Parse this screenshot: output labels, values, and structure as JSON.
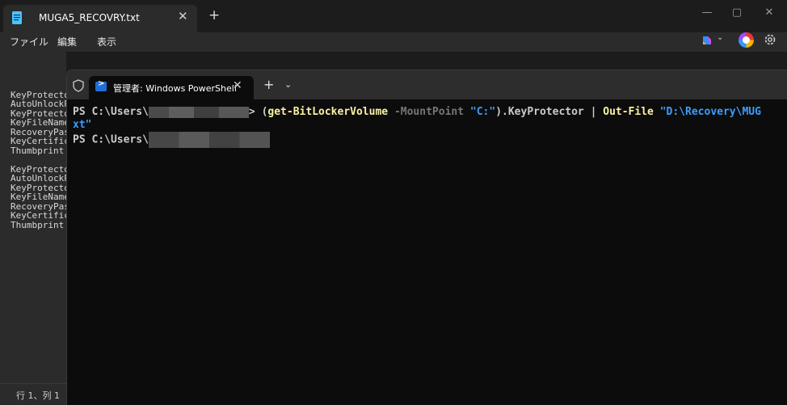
{
  "notepad": {
    "tab_title": "MUGA5_RECOVRY.txt",
    "tab_close": "✕",
    "new_tab": "+",
    "window_controls": [
      "—",
      "▢",
      "✕"
    ],
    "menu": [
      "ファイル",
      "編集",
      "表示"
    ],
    "visible_lines": [
      "KeyProtecto",
      "AutoUnlockP",
      "KeyProtecto",
      "KeyFileName",
      "RecoveryPas",
      "KeyCertifica",
      "Thumbprint",
      "",
      "KeyProtecto",
      "AutoUnlockP",
      "KeyProtecto",
      "KeyFileName",
      "RecoveryPas",
      "KeyCertifica",
      "Thumbprint"
    ],
    "status_position": "行 1、列 1",
    "icons": [
      "notepad-icon",
      "copilot-icon",
      "profile-icon",
      "gear-icon"
    ]
  },
  "powershell": {
    "tab_title": "管理者: Windows PowerShell",
    "tab_close": "✕",
    "new_tab": "+",
    "dropdown": "⌄",
    "prompt": "PS C:\\Users\\",
    "prompt_suffix": ">",
    "command": {
      "open_paren": "(",
      "cmdlet": "get-BitLockerVolume",
      "param": "-MountPoint",
      "arg": "\"C:\"",
      "close": ").KeyProtector",
      "pipe": "|",
      "cmdlet2": "Out-File",
      "path": "\"D:\\Recovery\\MUG",
      "path_wrap": "xt\""
    },
    "prompt2": "PS C:\\Users\\",
    "colors": {
      "cmdlet": "#f9f1a5",
      "param": "#767676",
      "string": "#3b9eff",
      "background": "#0c0c0c"
    }
  }
}
